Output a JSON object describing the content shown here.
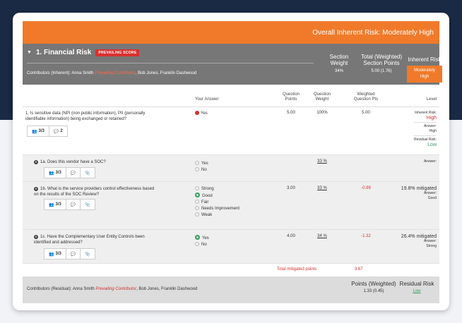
{
  "header": {
    "overall": "Overall Inherent Risk: Moderately High"
  },
  "section": {
    "title": "1. Financial Risk",
    "badge": "PREVAILING SCORE",
    "contrib_prefix": "Contributors (Inherent): Anna Smith ",
    "contrib_prevailing": "Prevailing Contributor",
    "contrib_suffix": ", Bob Jones, Franklin Dashwood",
    "weight_label_1": "Section",
    "weight_label_2": "Weight",
    "weight_value": "34%",
    "points_label_1": "Total (Weighted)",
    "points_label_2": "Section Points",
    "points_value": "5.00 (1.76)",
    "inherent_label": "Inherent Risk",
    "inherent_value": "Moderately High"
  },
  "columns": {
    "answer": "Your Answer",
    "qpoints_1": "Question",
    "qpoints_2": "Points",
    "qweight_1": "Question",
    "qweight_2": "Weight",
    "wqpts_1": "Weighted",
    "wqpts_2": "Question Pts",
    "level": "Level"
  },
  "questions": [
    {
      "text_1": "1. Is sensitive data (NPI (non public information), PII (personally",
      "text_2": "identifiable information) being exchanged or retained?",
      "answer": "Yes",
      "points": "5.00",
      "weight": "100%",
      "weighted": "5.00",
      "chip_users": "3/3",
      "chip_comments": "2",
      "lvl_inherent_label": "Inherent Risk:",
      "lvl_inherent": "High",
      "lvl_answer_label": "Answer:",
      "lvl_answer": "High",
      "lvl_residual_label": "Residual Risk:",
      "lvl_residual": "Low"
    },
    {
      "text_1": "1a. Does this vendor have a SOC?",
      "options": [
        "Yes",
        "No"
      ],
      "weight": "33 %",
      "chip_users": "3/3",
      "lvl_answer_label": "Answer:"
    },
    {
      "text_1": "1b. What is the service providers control effectiveness based",
      "text_2": "on the results of the SOC Review?",
      "options": [
        "Strong",
        "Good",
        "Fair",
        "Needs Improvement",
        "Weak"
      ],
      "points": "3.00",
      "weight": "33 %",
      "weighted": "-0.99",
      "chip_users": "3/3",
      "lvl_mitigated": "19.8% mitigated",
      "lvl_answer_label": "Answer:",
      "lvl_answer": "Good"
    },
    {
      "text_1": "1c. Have the Complementary User Entity Controls been",
      "text_2": "identified and addressed?",
      "options": [
        "Yes",
        "No"
      ],
      "points": "4.00",
      "weight": "34 %",
      "weighted": "-1.32",
      "chip_users": "3/3",
      "lvl_mitigated": "26.4% mitigated",
      "lvl_answer_label": "Answer:",
      "lvl_answer": "Strong"
    }
  ],
  "totals": {
    "label": "Total mitigated points",
    "value": "3.67"
  },
  "footer": {
    "contrib_prefix": "Contributors (Residual): Anna Smith ",
    "contrib_prevailing": "Prevailing Contributor",
    "contrib_suffix": ", Bob Jones, Franklin Dashwood",
    "points_label": "Points (Weighted)",
    "points_value": "1.33 (0.45)",
    "residual_label": "Residual Risk",
    "residual_value": "Low"
  },
  "colors": {
    "accent": "#f07a2a",
    "danger": "#d32f2f",
    "success": "#2e9e5a",
    "navy": "#1a2a44"
  },
  "icons": [
    "users-icon",
    "comment-icon",
    "paperclip-icon",
    "expand-icon"
  ]
}
